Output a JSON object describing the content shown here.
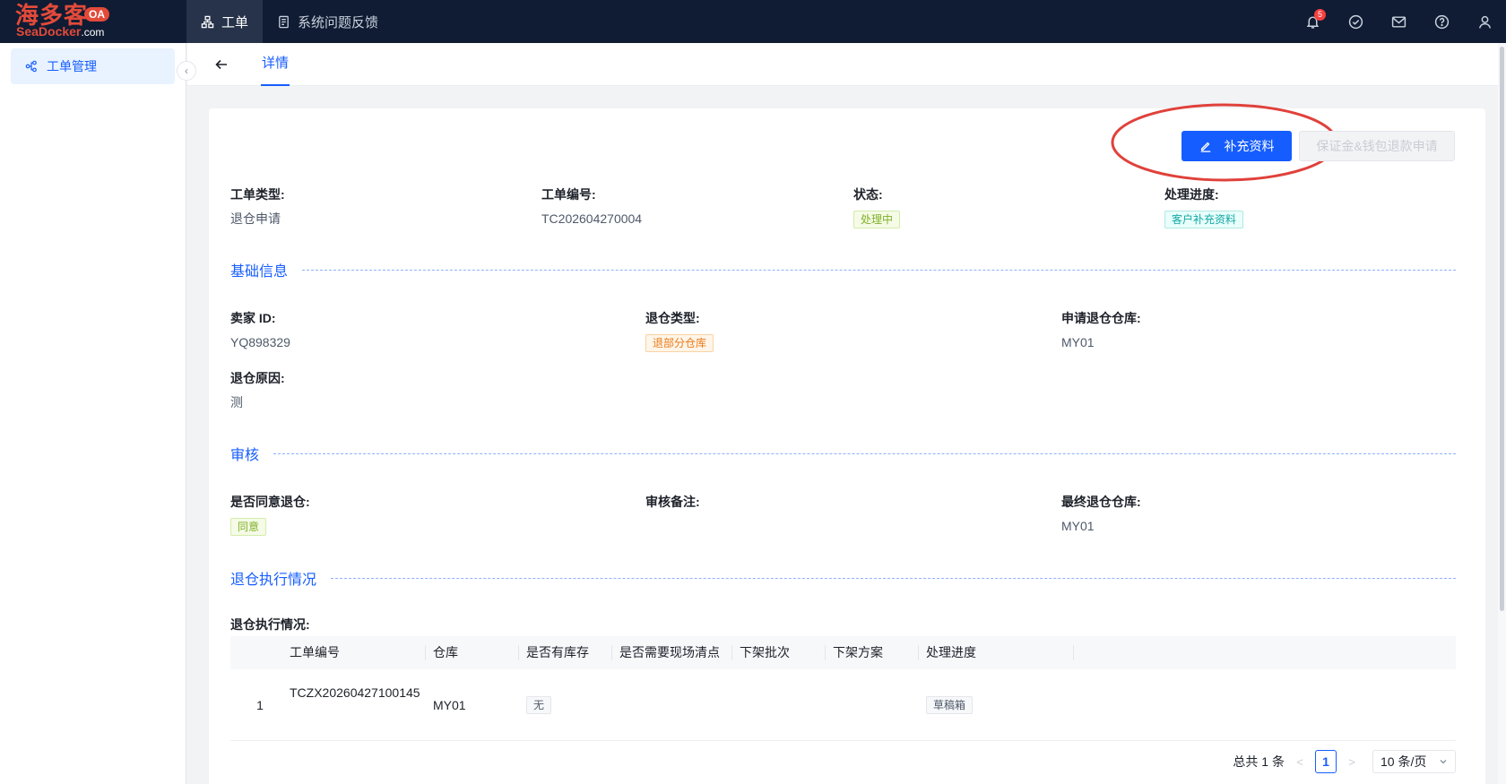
{
  "brand": {
    "logo_cn": "海多客",
    "logo_badge": "OA",
    "logo_en": "SeaDocker",
    "logo_domain": ".com"
  },
  "topnav": [
    {
      "label": "工单",
      "icon": "sitemap-icon"
    },
    {
      "label": "系统问题反馈",
      "icon": "document-icon"
    }
  ],
  "toolbar": {
    "notification_count": "5"
  },
  "sidebar": {
    "items": [
      {
        "label": "工单管理",
        "icon": "workflow-icon"
      }
    ]
  },
  "tabs": {
    "detail": "详情"
  },
  "actions": {
    "supplement": "补充资料",
    "refund": "保证金&钱包退款申请"
  },
  "summary": {
    "type_label": "工单类型:",
    "type_value": "退仓申请",
    "number_label": "工单编号:",
    "number_value": "TC202604270004",
    "status_label": "状态:",
    "status_value": "处理中",
    "progress_label": "处理进度:",
    "progress_value": "客户补充资料"
  },
  "basic": {
    "title": "基础信息",
    "seller_label": "卖家 ID:",
    "seller_value": "YQ898329",
    "return_type_label": "退仓类型:",
    "return_type_value": "退部分仓库",
    "apply_wh_label": "申请退仓仓库:",
    "apply_wh_value": "MY01",
    "reason_label": "退仓原因:",
    "reason_value": "测"
  },
  "review": {
    "title": "审核",
    "agree_label": "是否同意退仓:",
    "agree_value": "同意",
    "remark_label": "审核备注:",
    "final_wh_label": "最终退仓仓库:",
    "final_wh_value": "MY01"
  },
  "execution": {
    "title": "退仓执行情况",
    "table_label": "退仓执行情况:",
    "columns": [
      "工单编号",
      "仓库",
      "是否有库存",
      "是否需要现场清点",
      "下架批次",
      "下架方案",
      "处理进度"
    ],
    "rows": [
      {
        "index": "1",
        "number": "TCZX20260427100145",
        "warehouse": "MY01",
        "stock": "无",
        "count": "",
        "batch": "",
        "plan": "",
        "progress": "草稿箱"
      }
    ]
  },
  "pagination": {
    "total": "总共 1 条",
    "current": "1",
    "page_size": "10 条/页"
  },
  "colors": {
    "primary": "#165dff",
    "topbar": "#0f1c33",
    "brand_red": "#e34a3a",
    "highlight": "#e0413b"
  }
}
